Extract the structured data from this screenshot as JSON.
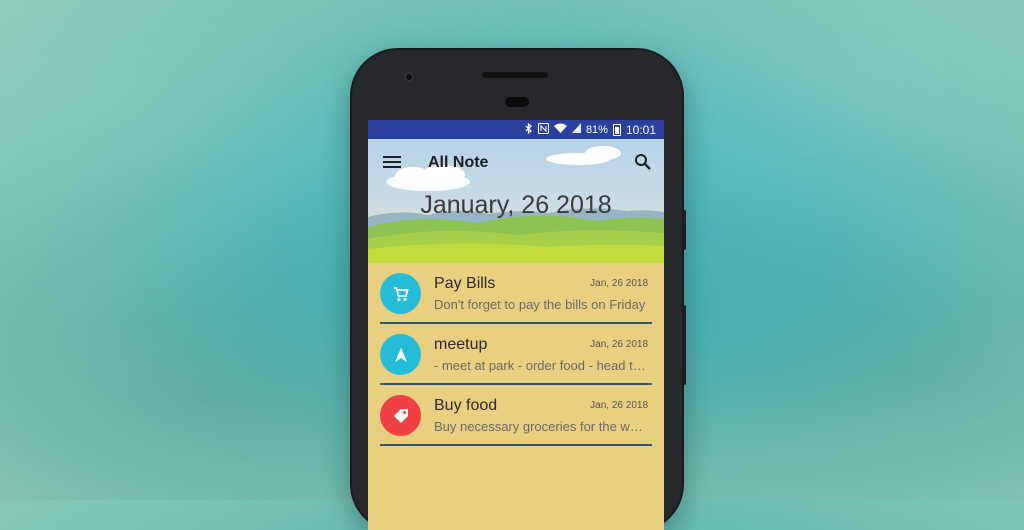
{
  "colors": {
    "status_bar": "#2b3f9f",
    "list_background": "#e9cf80",
    "divider": "#2e5a70",
    "avatar_cyan": "#26bcd7",
    "avatar_red": "#ef4043"
  },
  "status_bar": {
    "icons": [
      "bluetooth-icon",
      "nfc-icon",
      "wifi-icon",
      "signal-icon",
      "battery-icon"
    ],
    "battery": "81%",
    "time": "10:01"
  },
  "header": {
    "menu_icon": "hamburger-menu-icon",
    "title": "All Note",
    "search_icon": "search-icon",
    "date": "January, 26 2018"
  },
  "notes": [
    {
      "title": "Pay Bills",
      "date": "Jan, 26 2018",
      "preview": "Don't forget to pay the bills on Friday",
      "icon": "cart-icon",
      "color": "#26bcd7"
    },
    {
      "title": "meetup",
      "date": "Jan, 26 2018",
      "preview": "- meet at park - order food - head to the",
      "icon": "navigation-arrow-icon",
      "color": "#26bcd7"
    },
    {
      "title": "Buy food",
      "date": "Jan, 26 2018",
      "preview": "Buy necessary groceries for the week",
      "icon": "tag-icon",
      "color": "#ef4043"
    }
  ]
}
